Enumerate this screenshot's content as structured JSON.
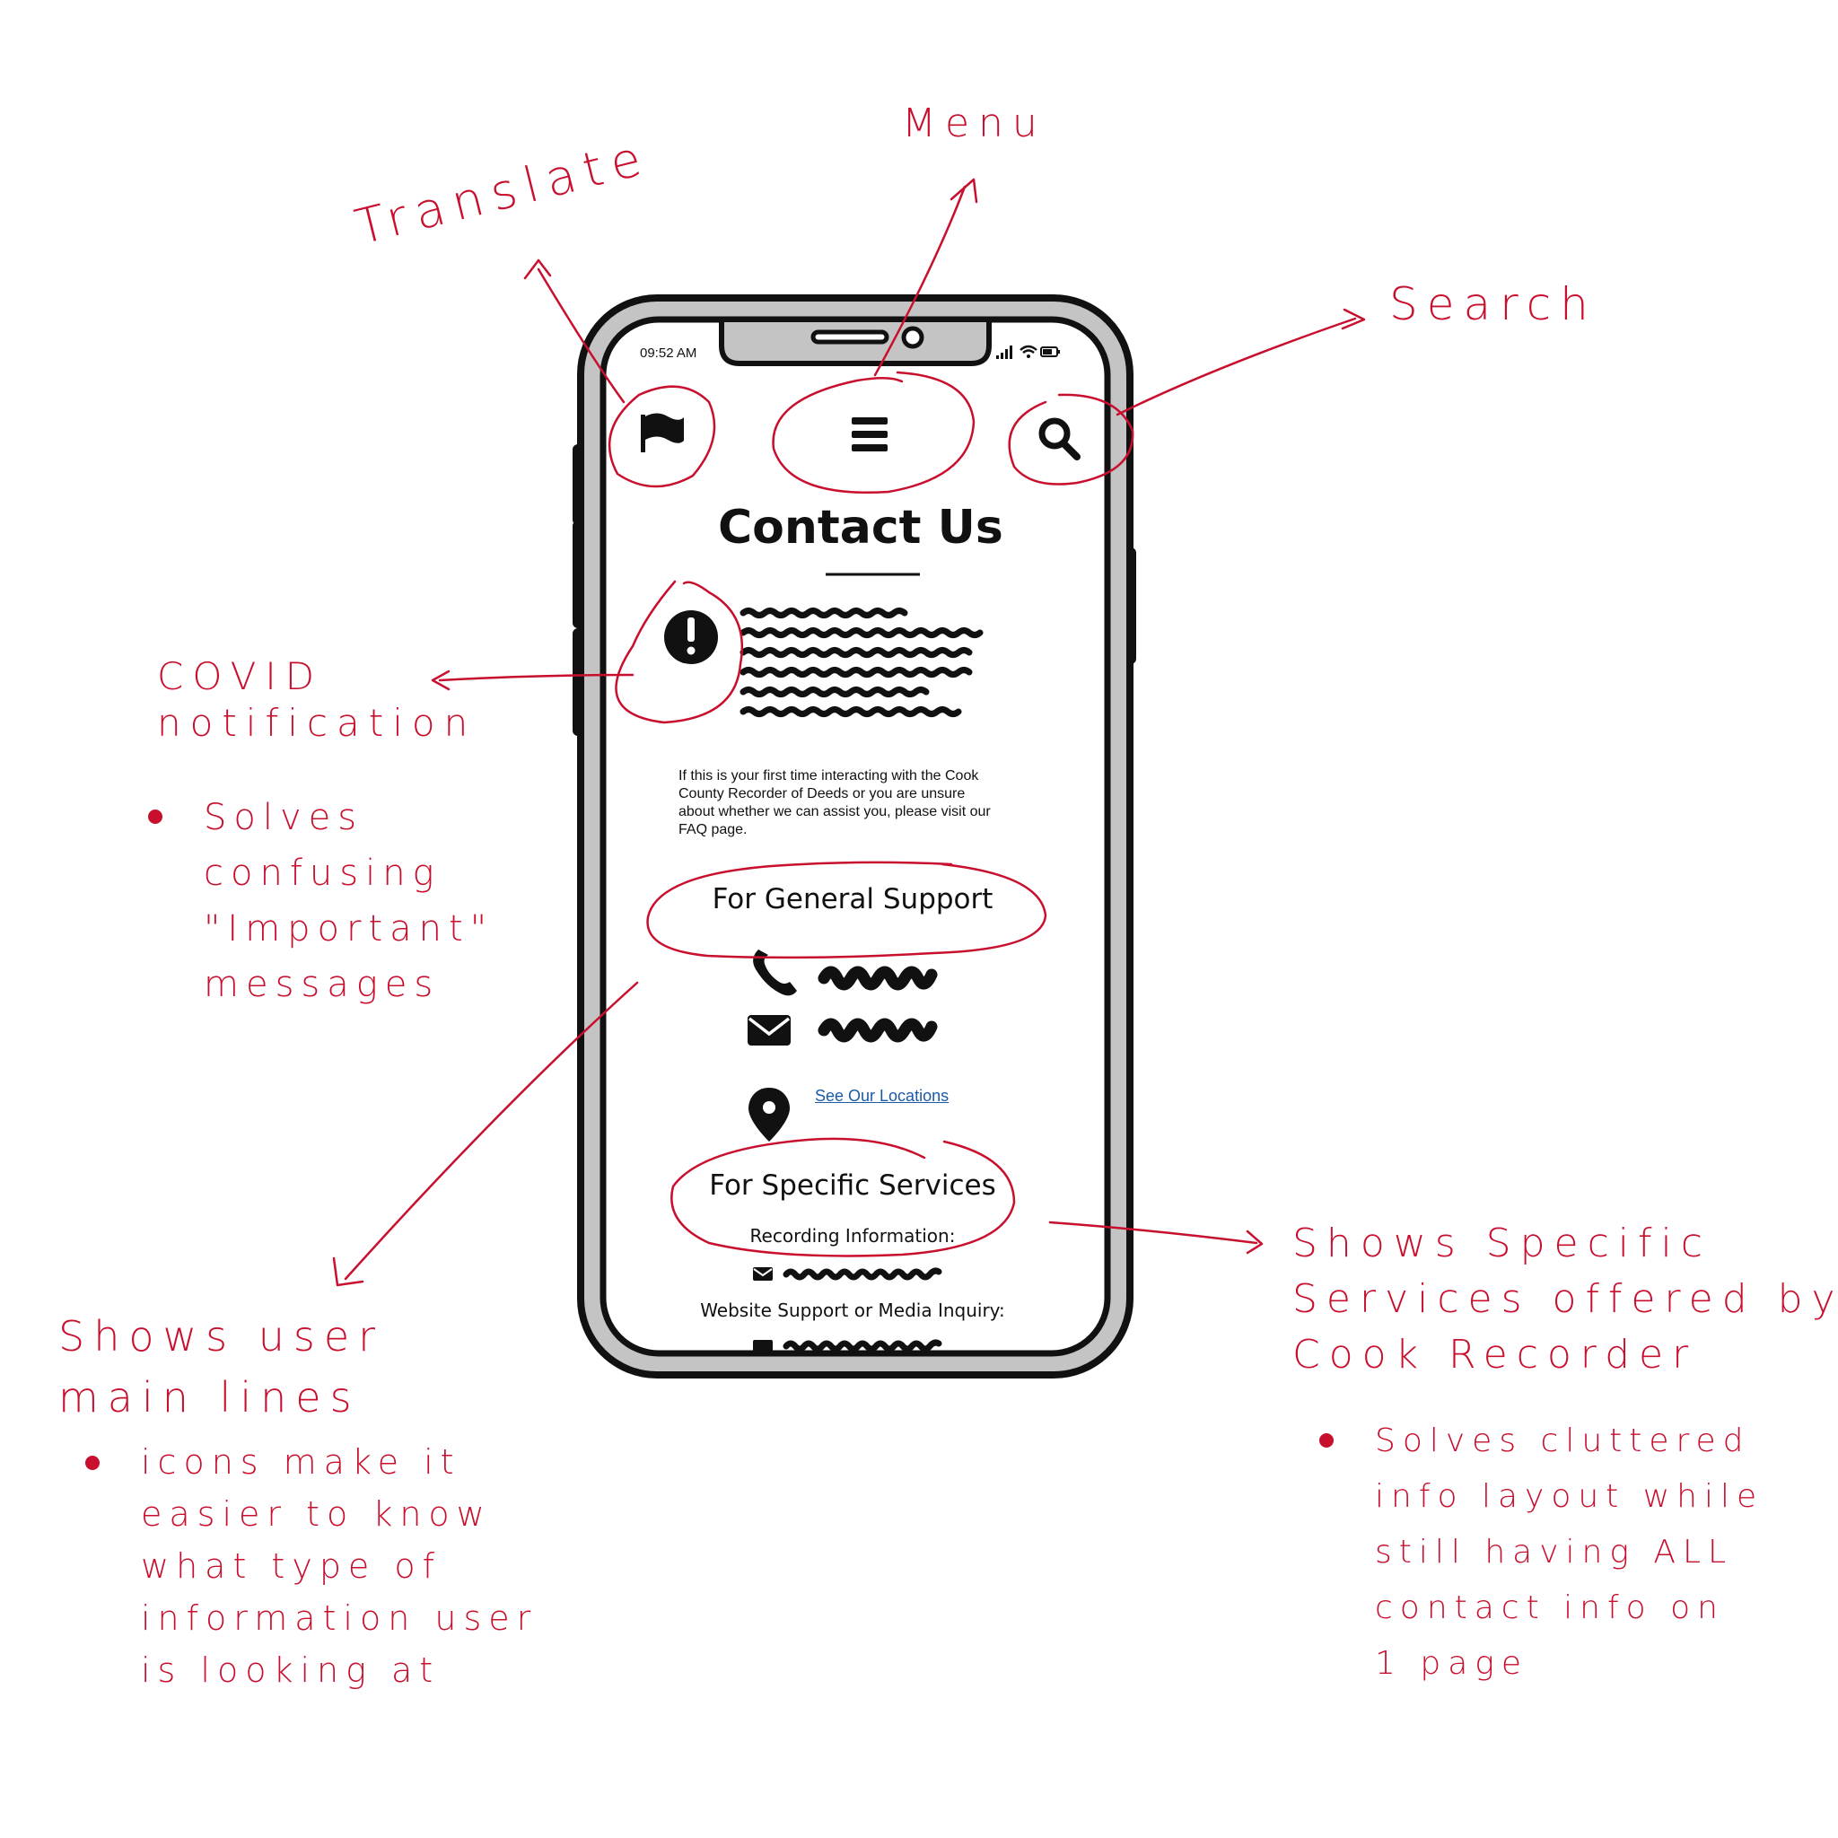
{
  "phone": {
    "status_bar": {
      "time": "09:52 AM"
    },
    "nav": {
      "translate_icon": "flag-icon",
      "menu_icon": "hamburger-menu-icon",
      "search_icon": "search-icon"
    },
    "title": "Contact Us",
    "notice_icon": "exclamation-circle-icon",
    "intro_lines": [
      "If this is your first time interacting with the Cook",
      "County Recorder of Deeds or you are unsure",
      "about whether we can assist you, please visit our",
      "FAQ page."
    ],
    "general_support": {
      "heading": "For General Support",
      "phone_icon": "phone-icon",
      "email_icon": "envelope-icon",
      "location_icon": "map-pin-icon",
      "locations_link": "See Our Locations"
    },
    "specific_services": {
      "heading": "For Specific Services",
      "recording_label": "Recording Information:",
      "website_label": "Website Support or Media Inquiry:"
    }
  },
  "annotations": {
    "translate": "Translate",
    "menu": "Menu",
    "search": "Search",
    "covid": {
      "lines": [
        "COVID",
        "notification"
      ],
      "bullets": [
        [
          "Solves",
          "confusing",
          "\"Important\"",
          "messages"
        ]
      ]
    },
    "user_lines": {
      "lines": [
        "Shows user",
        "main lines"
      ],
      "bullets": [
        [
          "icons make it",
          "easier to know",
          "what type of",
          "information user",
          "is looking at"
        ]
      ]
    },
    "services": {
      "lines": [
        "Shows Specific",
        "Services offered by",
        "Cook Recorder"
      ],
      "bullets": [
        [
          "Solves cluttered",
          "info layout while",
          "still having ALL",
          "contact info on",
          "1 page"
        ]
      ]
    }
  },
  "colors": {
    "annotation": "#c8102e",
    "phone_frame": "#c4c4c4",
    "ink": "#111111",
    "link": "#1a5aa8"
  }
}
